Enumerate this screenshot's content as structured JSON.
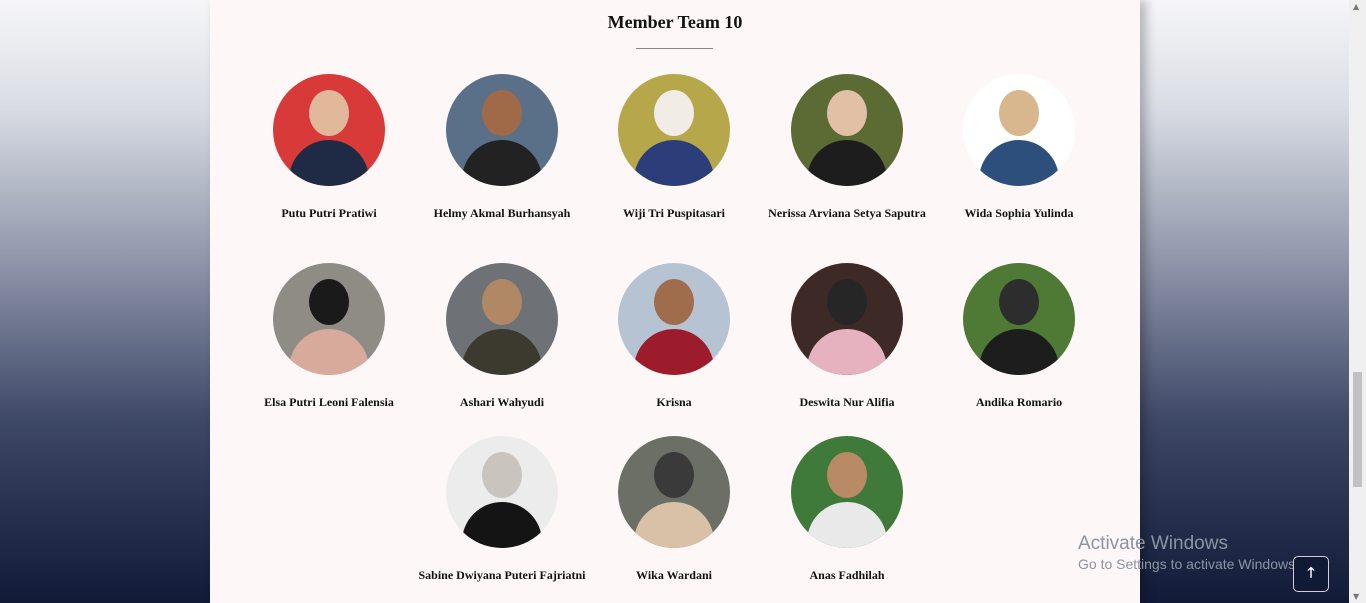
{
  "section": {
    "title": "Member Team 10"
  },
  "members": [
    {
      "name": "Putu Putri Pratiwi",
      "bg": "#d83a3a",
      "skin": "#e1b89a",
      "cloth": "#1f2a44"
    },
    {
      "name": "Helmy Akmal Burhansyah",
      "bg": "#5a6f88",
      "skin": "#a06a48",
      "cloth": "#222222"
    },
    {
      "name": "Wiji Tri Puspitasari",
      "bg": "#b6a74a",
      "skin": "#f1ece6",
      "cloth": "#2b3e7a"
    },
    {
      "name": "Nerissa Arviana Setya Saputra",
      "bg": "#5b6b33",
      "skin": "#e2c0a5",
      "cloth": "#1d1d1d"
    },
    {
      "name": "Wida Sophia Yulinda",
      "bg": "#ffffff",
      "skin": "#d8b78e",
      "cloth": "#2d4f7c"
    },
    {
      "name": "Elsa Putri Leoni Falensia",
      "bg": "#8f8c86",
      "skin": "#1a1a1a",
      "cloth": "#d7aa9b"
    },
    {
      "name": "Ashari Wahyudi",
      "bg": "#6e7277",
      "skin": "#b08866",
      "cloth": "#3c3a2e"
    },
    {
      "name": "Krisna",
      "bg": "#b6c3d2",
      "skin": "#a06d4c",
      "cloth": "#9d1c2c"
    },
    {
      "name": "Deswita Nur Alifia",
      "bg": "#3d2925",
      "skin": "#262626",
      "cloth": "#e6b2c0"
    },
    {
      "name": "Andika Romario",
      "bg": "#4f7a35",
      "skin": "#2d2d2d",
      "cloth": "#1d1d1d"
    },
    {
      "name": "Sabine Dwiyana Puteri Fajriatni",
      "bg": "#ececec",
      "skin": "#c9c4be",
      "cloth": "#141414"
    },
    {
      "name": "Wika Wardani",
      "bg": "#6c6f66",
      "skin": "#3a3a3a",
      "cloth": "#d9c1a7"
    },
    {
      "name": "Anas Fadhilah",
      "bg": "#3f7a3a",
      "skin": "#b88a66",
      "cloth": "#e9e9e9"
    }
  ],
  "watermark": {
    "line1": "Activate Windows",
    "line2": "Go to Settings to activate Windows."
  },
  "back_to_top": {
    "icon": "arrow-up-icon",
    "glyph": "🡑"
  },
  "scrollbar": {
    "up": "▲",
    "down": "▼"
  }
}
